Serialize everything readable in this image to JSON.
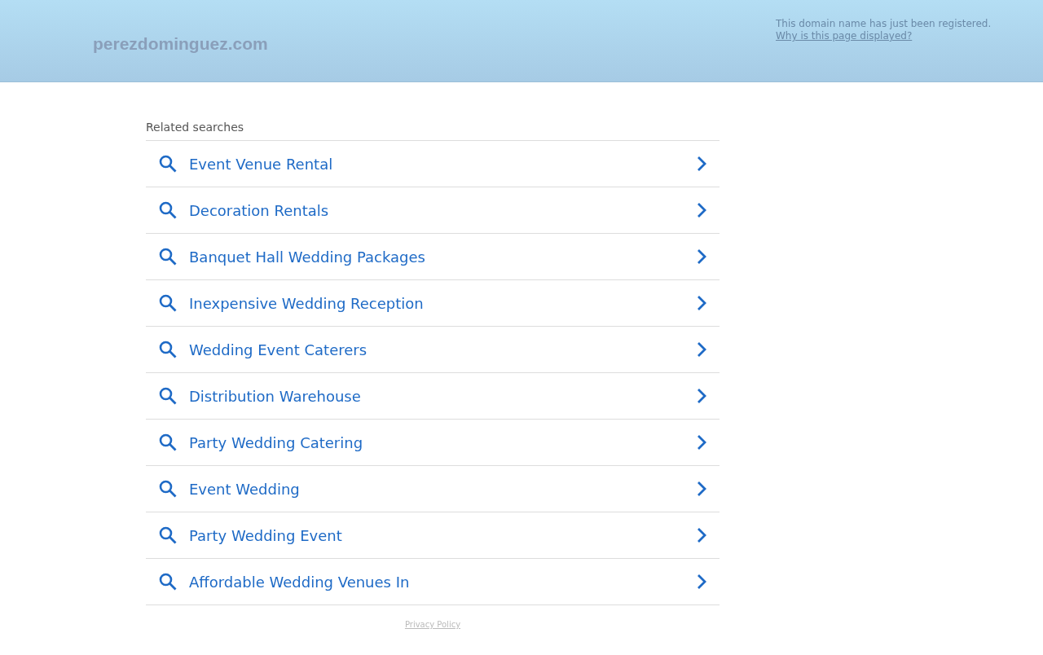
{
  "header": {
    "domain": "perezdominguez.com",
    "notice": "This domain name has just been registered.",
    "notice_link": "Why is this page displayed?"
  },
  "related": {
    "heading": "Related searches",
    "items": [
      "Event Venue Rental",
      "Decoration Rentals",
      "Banquet Hall Wedding Packages",
      "Inexpensive Wedding Reception",
      "Wedding Event Caterers",
      "Distribution Warehouse",
      "Party Wedding Catering",
      "Event Wedding",
      "Party Wedding Event",
      "Affordable Wedding Venues In"
    ]
  },
  "footer": {
    "privacy_link": "Privacy Policy"
  }
}
